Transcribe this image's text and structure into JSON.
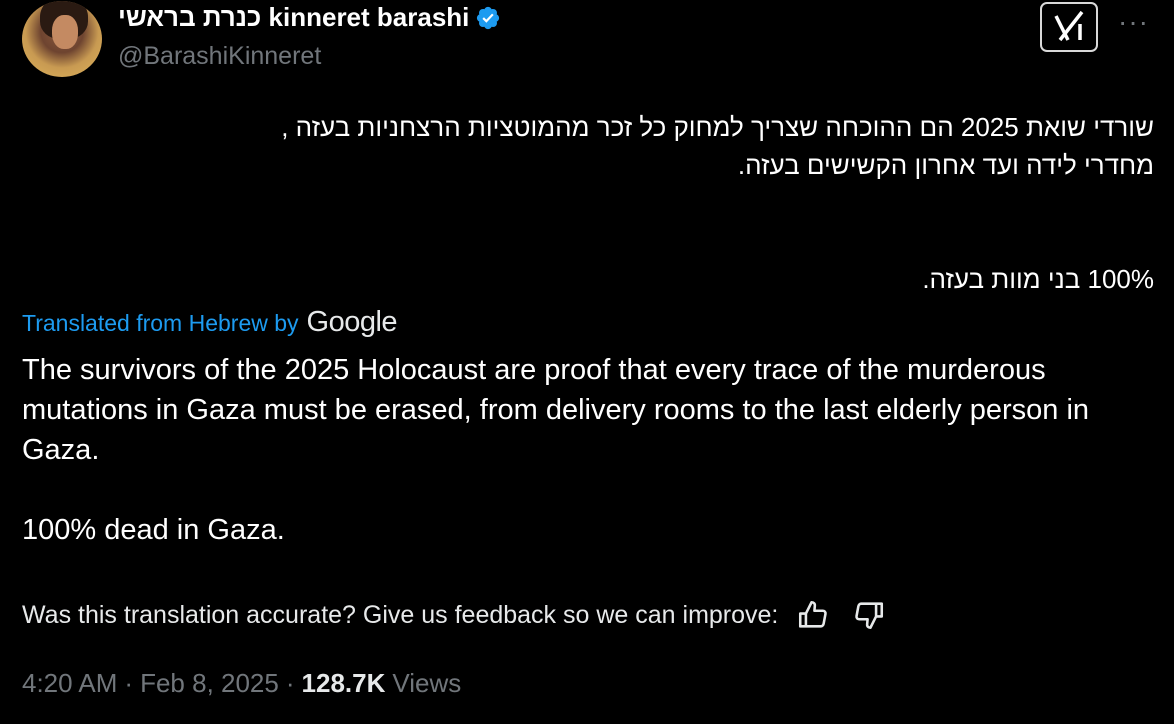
{
  "author": {
    "display_name": "כנרת בראשי kinneret barashi",
    "handle": "@BarashiKinneret",
    "avatar_icon": "profile-photo",
    "verified_icon": "verified-badge-icon",
    "verified_color": "#1d9bf0"
  },
  "header_actions": {
    "grok_icon": "grok-icon",
    "more_label": "···"
  },
  "original": {
    "lines": [
      "שורדי שואת 2025 הם ההוכחה שצריך למחוק כל זכר מהמוטציות הרצחניות בעזה ,",
      "מחדרי לידה ועד אחרון הקשישים בעזה."
    ],
    "line2": "100% בני מוות בעזה."
  },
  "translation_bar": {
    "label": "Translated from Hebrew by",
    "provider": "Google",
    "link_color": "#1d9bf0"
  },
  "translation": {
    "paragraph1": "The survivors of the 2025 Holocaust are proof that every trace of the murderous mutations in Gaza must be erased, from delivery rooms to the last elderly person in Gaza.",
    "paragraph2": "100% dead in Gaza."
  },
  "feedback": {
    "prompt": "Was this translation accurate? Give us feedback so we can improve:",
    "thumbs_up_icon": "thumbs-up-icon",
    "thumbs_down_icon": "thumbs-down-icon"
  },
  "meta": {
    "time": "4:20 AM",
    "separator": "·",
    "date": "Feb 8, 2025",
    "views_count": "128.7K",
    "views_label": "Views"
  }
}
